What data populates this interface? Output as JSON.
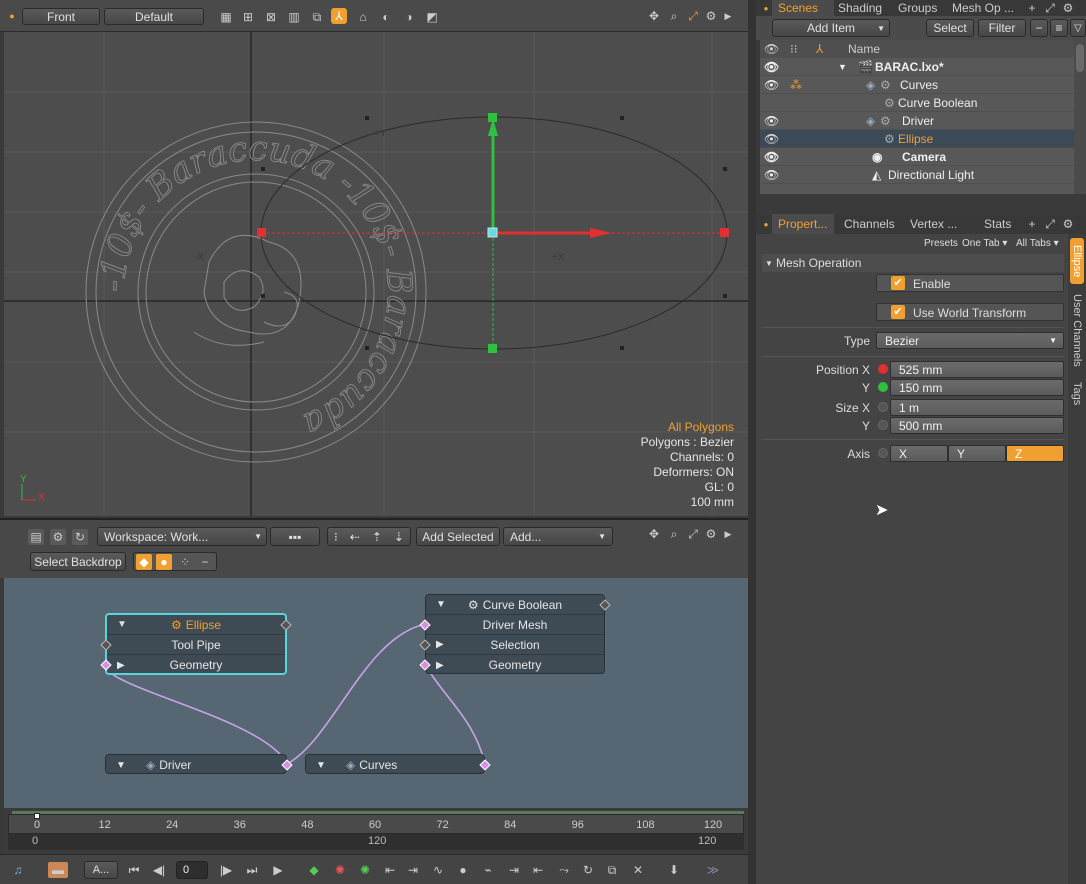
{
  "viewport": {
    "view_label": "Front",
    "style_label": "Default",
    "info": {
      "line1": "All Polygons",
      "line2": "Polygons : Bezier",
      "line3": "Channels: 0",
      "line4": "Deformers: ON",
      "line5": "GL: 0",
      "line6": "100 mm"
    },
    "axis_x": "X",
    "axis_y": "Y",
    "stamp_text": "-10$- Baraccuda -10$- Baraccuda"
  },
  "schematic": {
    "workspace": "Workspace: Work...",
    "add_selected": "Add Selected",
    "add": "Add...",
    "select_backdrop": "Select Backdrop",
    "nodes": {
      "ellipse": {
        "title": "Ellipse",
        "row1": "Tool Pipe",
        "row2": "Geometry"
      },
      "curve_boolean": {
        "title": "Curve Boolean",
        "row1": "Driver Mesh",
        "row2": "Selection",
        "row3": "Geometry"
      },
      "driver": {
        "title": "Driver"
      },
      "curves": {
        "title": "Curves"
      }
    }
  },
  "timeline": {
    "ticks": [
      "0",
      "12",
      "24",
      "36",
      "48",
      "60",
      "72",
      "84",
      "96",
      "108",
      "120"
    ],
    "range_start": "0",
    "range_mid": "120",
    "range_end": "120",
    "current_frame": "0",
    "audio_label": "A..."
  },
  "scenes": {
    "tabs": [
      "Scenes",
      "Shading",
      "Groups",
      "Mesh Op ..."
    ],
    "add_item": "Add Item",
    "select": "Select",
    "filter": "Filter",
    "column_name": "Name",
    "items": [
      {
        "label": "BARAC.lxo*"
      },
      {
        "label": "Curves"
      },
      {
        "label": "Curve Boolean"
      },
      {
        "label": "Driver"
      },
      {
        "label": "Ellipse"
      },
      {
        "label": "Camera"
      },
      {
        "label": "Directional Light"
      }
    ]
  },
  "properties": {
    "tabs": [
      "Propert...",
      "Channels",
      "Vertex ...",
      "Stats"
    ],
    "presets": "Presets",
    "one_tab": "One Tab",
    "all_tabs": "All Tabs",
    "section": "Mesh Operation",
    "enable": "Enable",
    "use_world": "Use World Transform",
    "type_label": "Type",
    "type_value": "Bezier",
    "pos_x_label": "Position X",
    "pos_x": "525 mm",
    "pos_y_label": "Y",
    "pos_y": "150 mm",
    "size_x_label": "Size X",
    "size_x": "1 m",
    "size_y_label": "Y",
    "size_y": "500 mm",
    "axis_label": "Axis",
    "axis_options": [
      "X",
      "Y",
      "Z"
    ],
    "axis_selected": "Z",
    "side_tabs": [
      "Ellipse",
      "User Channels",
      "Tags"
    ]
  },
  "colors": {
    "accent": "#f0a030",
    "node_selected": "#56d6d9",
    "link": "#c9a3e6",
    "handle_red": "#e03030",
    "handle_green": "#30c040"
  }
}
